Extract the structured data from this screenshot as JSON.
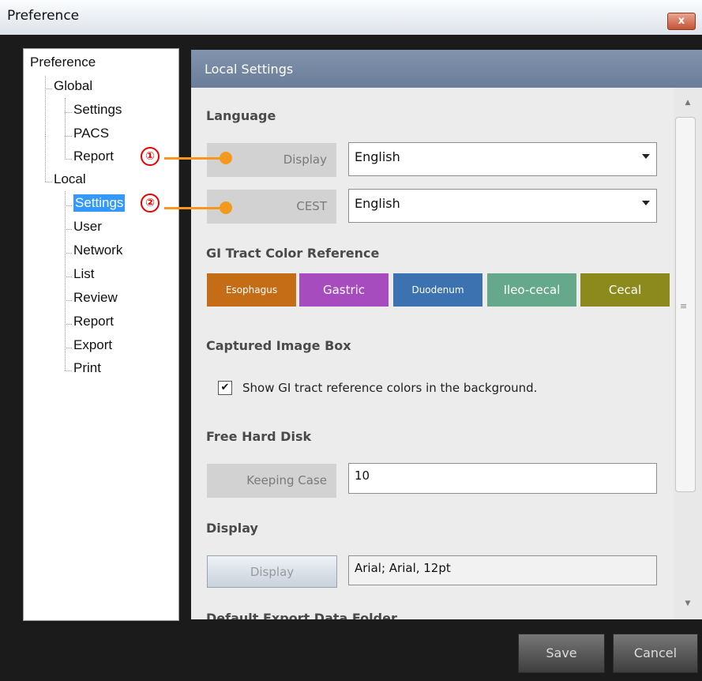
{
  "window": {
    "title": "Preference",
    "close_glyph": "x"
  },
  "tree": {
    "root": "Preference",
    "global": "Global",
    "global_settings": "Settings",
    "global_pacs": "PACS",
    "global_report": "Report",
    "local": "Local",
    "local_settings": "Settings",
    "local_user": "User",
    "local_network": "Network",
    "local_list": "List",
    "local_review": "Review",
    "local_report": "Report",
    "local_export": "Export",
    "local_print": "Print",
    "selected": "local_settings",
    "selected_color": "#3399ff"
  },
  "callouts": {
    "one": "①",
    "two": "②",
    "color": "#f39a1e"
  },
  "panel": {
    "title": "Local Settings",
    "language": {
      "heading": "Language",
      "display_label": "Display",
      "display_value": "English",
      "cest_label": "CEST",
      "cest_value": "English"
    },
    "gi_tract": {
      "heading": "GI Tract Color Reference",
      "swatches": [
        {
          "label": "Esophagus",
          "color": "#c46d16"
        },
        {
          "label": "Gastric",
          "color": "#a64cbf"
        },
        {
          "label": "Duodenum",
          "color": "#3d72b0"
        },
        {
          "label": "Ileo-cecal",
          "color": "#66a88c"
        },
        {
          "label": "Cecal",
          "color": "#8c8a1c"
        }
      ]
    },
    "captured_image": {
      "heading": "Captured Image Box",
      "checkbox_label": "Show GI tract reference colors in the background.",
      "checked": true
    },
    "free_disk": {
      "heading": "Free Hard Disk",
      "keeping_label": "Keeping Case",
      "keeping_value": "10"
    },
    "display": {
      "heading": "Display",
      "button": "Display",
      "font_value": "Arial; Arial, 12pt"
    },
    "next_section_partial": "Default Export Data Folder"
  },
  "footer": {
    "save": "Save",
    "cancel": "Cancel"
  },
  "icons": {
    "close": "close-icon",
    "checkbox": "checkmark-icon",
    "dropdown": "chevron-down-icon",
    "scroll_up": "scroll-up-icon",
    "scroll_down": "scroll-down-icon"
  }
}
